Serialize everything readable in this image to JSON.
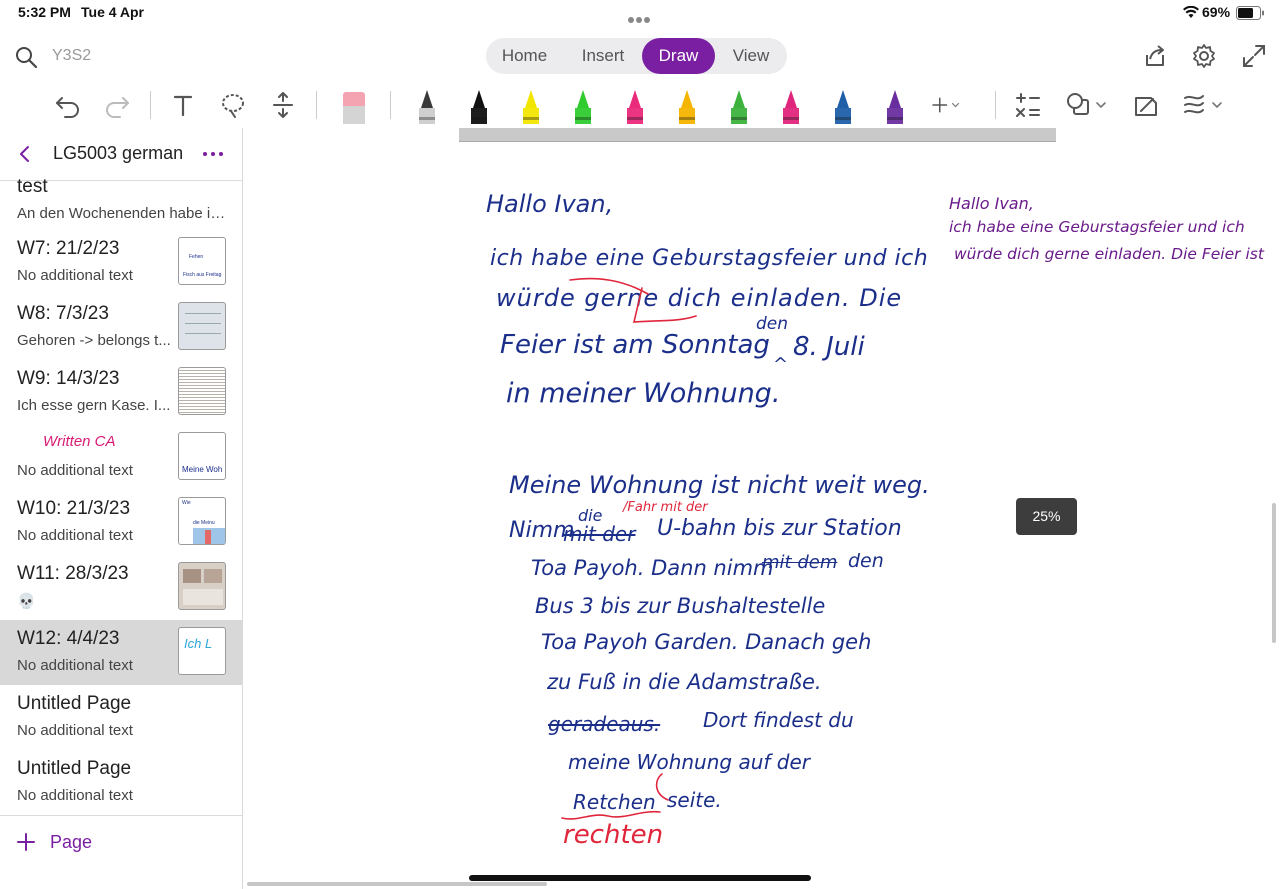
{
  "status_bar": {
    "time": "5:32 PM",
    "date": "Tue 4 Apr",
    "battery": "69%"
  },
  "top_bar": {
    "notebook_name": "Y3S2",
    "tabs": [
      {
        "label": "Home",
        "active": false
      },
      {
        "label": "Insert",
        "active": false
      },
      {
        "label": "Draw",
        "active": true
      },
      {
        "label": "View",
        "active": false
      }
    ]
  },
  "toolbar": {
    "pen_colors": [
      "#3a3a3a",
      "#111111",
      "#f2e600",
      "#2fcb2f",
      "#ea2a7b",
      "#f5b400",
      "#3cb23c",
      "#e0267c",
      "#1f5fa8",
      "#6a2d9f"
    ]
  },
  "sidebar": {
    "section_title": "LG5003 german",
    "pages": [
      {
        "title": "test",
        "subtitle": "An den Wochenenden habe ic..."
      },
      {
        "title": "W7: 21/2/23",
        "subtitle": "No additional text"
      },
      {
        "title": "W8: 7/3/23",
        "subtitle": "Gehoren -> belongs t..."
      },
      {
        "title": "W9: 14/3/23",
        "subtitle": "Ich esse gern Kase. I..."
      },
      {
        "title": "Written CA",
        "subtitle": "No additional text"
      },
      {
        "title": "W10: 21/3/23",
        "subtitle": "No additional text"
      },
      {
        "title": "W11: 28/3/23",
        "subtitle": "💀"
      },
      {
        "title": "W12: 4/4/23",
        "subtitle": "No additional text",
        "selected": true
      },
      {
        "title": "Untitled Page",
        "subtitle": "No additional text"
      },
      {
        "title": "Untitled Page",
        "subtitle": "No additional text"
      }
    ],
    "thumbs": {
      "w7_line1": "Fehen",
      "w7_line2": "Fisch aus Freitag",
      "written_ca": "Meine Woh",
      "w10_a": "Wie",
      "w10_b": "die Meinu",
      "w12": "Ich L"
    },
    "add_page_label": "Page"
  },
  "canvas": {
    "zoom": "25%",
    "letter": {
      "greeting": "Hallo Ivan,",
      "l1": "ich habe eine Geburstagsfeier und ich",
      "l2": "würde gerne dich einladen. Die",
      "l3": "Feier ist am Sonntag",
      "l3_insert": "den",
      "l3_end": "8. Juli",
      "l4": "in meiner Wohnung.",
      "p2_l1": "Meine Wohnung ist nicht weit weg.",
      "p2_l2a": "Nimm",
      "p2_l2_strike": "mit der",
      "p2_l2_above": "die",
      "p2_l2_above2": "/Fahr mit der",
      "p2_l2b": "U-bahn bis zur Station",
      "p2_l3a": "Toa Payoh. Dann nimm",
      "p2_l3_strike": "mit dem",
      "p2_l3b": "den",
      "p2_l4": "Bus 3 bis zur Bushaltestelle",
      "p2_l5": "Toa Payoh Garden. Danach geh",
      "p2_l6": "zu Fuß in die Adamstraße.",
      "p2_l7_strike": "geradeaus.",
      "p2_l7": "Dort findest du",
      "p2_l8": "meine Wohnung auf der",
      "p2_l9a": "Retchen",
      "p2_l9b": "seite.",
      "correction": "rechten"
    },
    "side_note": {
      "l1": "Hallo Ivan,",
      "l2": "ich habe eine Geburstagsfeier und ich",
      "l3": "würde dich gerne einladen. Die Feier ist"
    }
  }
}
